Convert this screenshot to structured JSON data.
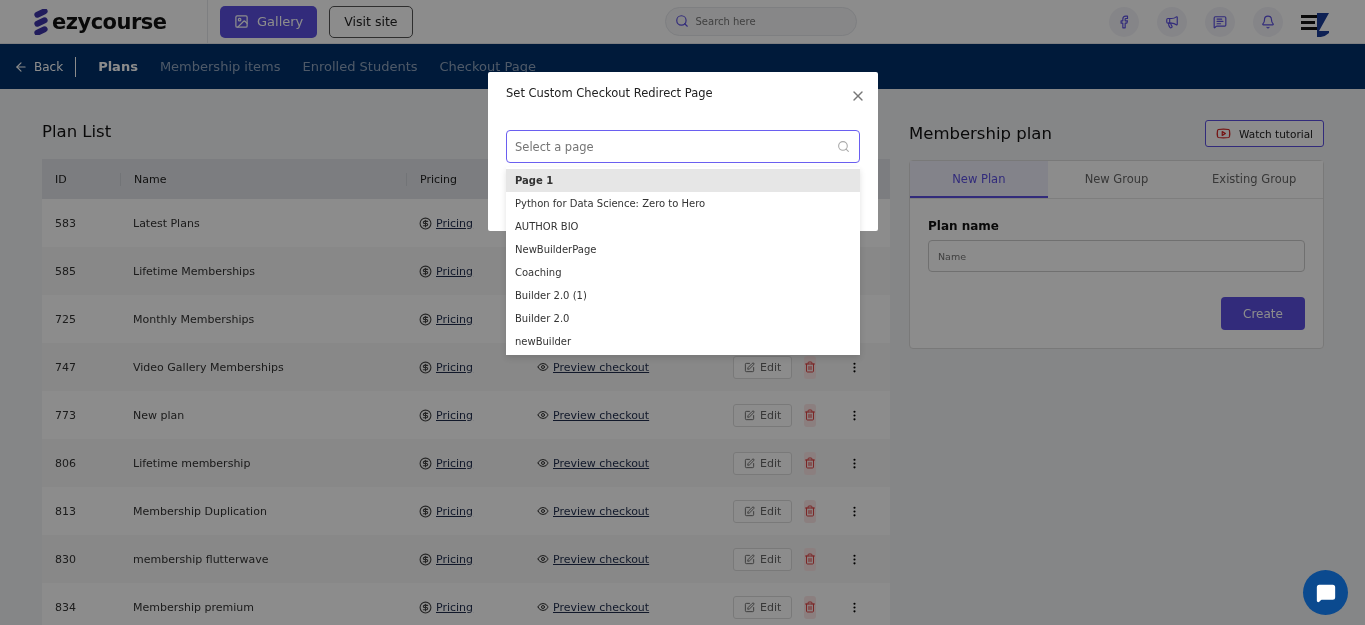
{
  "topbar": {
    "logo": "ezycourse",
    "gallery_button": "Gallery",
    "visit_button": "Visit site",
    "search": {
      "placeholder": "Search here"
    }
  },
  "nav": {
    "back": "Back",
    "tabs": [
      {
        "label": "Plans",
        "selected": true
      },
      {
        "label": "Membership items",
        "selected": false
      },
      {
        "label": "Enrolled Students",
        "selected": false
      },
      {
        "label": "Checkout Page",
        "selected": false
      }
    ]
  },
  "plan_list": {
    "title": "Plan List",
    "columns": [
      "ID",
      "Name",
      "Pricing"
    ],
    "rows": [
      {
        "id": "583",
        "name": "Latest Plans",
        "pricing": "Pricing"
      },
      {
        "id": "585",
        "name": "Lifetime Memberships",
        "pricing": "Pricing"
      },
      {
        "id": "725",
        "name": "Monthly Memberships",
        "pricing": "Pricing"
      },
      {
        "id": "747",
        "name": "Video Gallery Memberships",
        "pricing": "Pricing",
        "preview": "Preview checkout",
        "edit": "Edit"
      },
      {
        "id": "773",
        "name": "New plan",
        "pricing": "Pricing",
        "preview": "Preview checkout",
        "edit": "Edit"
      },
      {
        "id": "806",
        "name": "Lifetime membership",
        "pricing": "Pricing",
        "preview": "Preview checkout",
        "edit": "Edit"
      },
      {
        "id": "813",
        "name": "Membership Duplication",
        "pricing": "Pricing",
        "preview": "Preview checkout",
        "edit": "Edit"
      },
      {
        "id": "830",
        "name": "membership flutterwave",
        "pricing": "Pricing",
        "preview": "Preview checkout",
        "edit": "Edit"
      },
      {
        "id": "834",
        "name": "Membership premium",
        "pricing": "Pricing",
        "preview": "Preview checkout",
        "edit": "Edit"
      }
    ]
  },
  "membership_plan": {
    "title": "Membership plan",
    "tutorial_button": "Watch tutorial",
    "tabs": [
      {
        "label": "New Plan",
        "selected": true
      },
      {
        "label": "New Group",
        "selected": false
      },
      {
        "label": "Existing Group",
        "selected": false
      }
    ],
    "field_label": "Plan name",
    "field_placeholder": "Name",
    "create_button": "Create"
  },
  "modal": {
    "title": "Set Custom Checkout Redirect Page",
    "search": {
      "placeholder": "Select a page"
    },
    "options": [
      {
        "label": "Page 1",
        "selected": true
      },
      {
        "label": "Python for Data Science: Zero to Hero",
        "selected": false
      },
      {
        "label": "AUTHOR BIO",
        "selected": false
      },
      {
        "label": "NewBuilderPage",
        "selected": false
      },
      {
        "label": "Coaching",
        "selected": false
      },
      {
        "label": "Builder 2.0 (1)",
        "selected": false
      },
      {
        "label": "Builder 2.0",
        "selected": false
      },
      {
        "label": "newBuilder",
        "selected": false
      }
    ]
  }
}
